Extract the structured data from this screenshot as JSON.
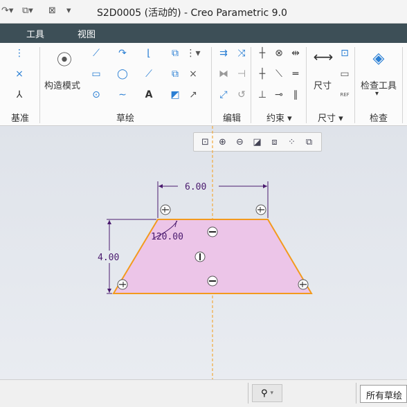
{
  "window": {
    "title": "S2D0005 (活动的) - Creo Parametric 9.0"
  },
  "menu": {
    "items": [
      "工具",
      "视图"
    ]
  },
  "ribbon": {
    "groups": [
      {
        "label": "基准"
      },
      {
        "label": "草绘"
      },
      {
        "label": "编辑"
      },
      {
        "label": "约束 ▾"
      },
      {
        "label": "尺寸 ▾"
      },
      {
        "label": "检查"
      }
    ],
    "construction_mode_label": "构造模式",
    "dimension_label": "尺寸",
    "inspect_tools_label": "检查工具",
    "ref_label": "REF"
  },
  "sketch": {
    "dimensions": {
      "top_width": "6.00",
      "height": "4.00",
      "angle": "120.00"
    },
    "fill_color": "#ecc5e8",
    "edge_color": "#f39a1d",
    "dimension_color": "#4a1a6e",
    "centerline_color": "#f2a93a"
  },
  "statusbar": {
    "filter_value": "所有草绘"
  }
}
